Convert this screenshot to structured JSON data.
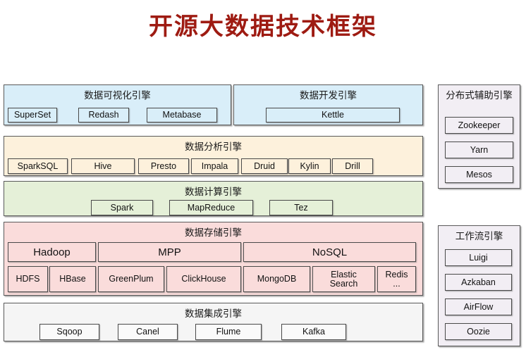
{
  "page": {
    "title": "开源大数据技术框架",
    "title_color": "#9e1b12",
    "background": "#ffffff"
  },
  "diagram": {
    "type": "layered-block-diagram",
    "left_column": [
      {
        "id": "visualization",
        "title": "数据可视化引擎",
        "color": "#d9eef9",
        "items": [
          "SuperSet",
          "Redash",
          "Metabase"
        ]
      },
      {
        "id": "development",
        "title": "数据开发引擎",
        "color": "#d9eef9",
        "items": [
          "Kettle"
        ]
      },
      {
        "id": "analysis",
        "title": "数据分析引擎",
        "color": "#fdf1dc",
        "items": [
          "SparkSQL",
          "Hive",
          "Presto",
          "Impala",
          "Druid",
          "Kylin",
          "Drill"
        ]
      },
      {
        "id": "compute",
        "title": "数据计算引擎",
        "color": "#e5f0d8",
        "items": [
          "Spark",
          "MapReduce",
          "Tez"
        ]
      },
      {
        "id": "storage",
        "title": "数据存储引擎",
        "color": "#fadcdb",
        "groups": [
          "Hadoop",
          "MPP",
          "NoSQL"
        ],
        "items": [
          "HDFS",
          "HBase",
          "GreenPlum",
          "ClickHouse",
          "MongoDB",
          "Elastic\nSearch",
          "Redis\n..."
        ]
      },
      {
        "id": "integration",
        "title": "数据集成引擎",
        "color": "#f5f5f5",
        "items": [
          "Sqoop",
          "Canel",
          "Flume",
          "Kafka"
        ]
      }
    ],
    "right_column": [
      {
        "id": "distributed-assist",
        "title": "分布式辅助引擎",
        "color": "#f2eef4",
        "items": [
          "Zookeeper",
          "Yarn",
          "Mesos"
        ]
      },
      {
        "id": "workflow",
        "title": "工作流引擎",
        "color": "#f2eef4",
        "items": [
          "Luigi",
          "Azkaban",
          "AirFlow",
          "Oozie"
        ]
      }
    ]
  }
}
